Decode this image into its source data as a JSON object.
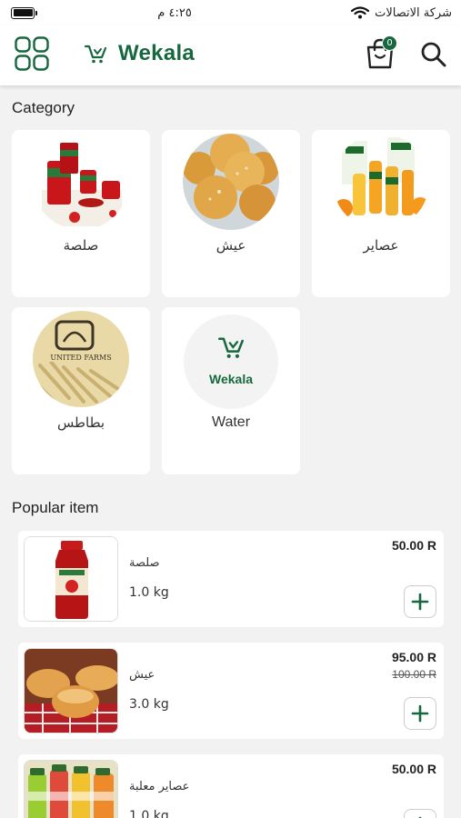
{
  "status_bar": {
    "time": "٤:٢٥ م",
    "carrier": "شركة الاتصالات"
  },
  "header": {
    "brand": "Wekala",
    "cart_count": "0"
  },
  "categories_section": {
    "title": "Category"
  },
  "categories": [
    {
      "label": "صلصة",
      "icon": "tomato-paste-image"
    },
    {
      "label": "عيش",
      "icon": "bread-rolls-image"
    },
    {
      "label": "عصاير",
      "icon": "juice-bottles-image"
    },
    {
      "label": "بطاطس",
      "icon": "fries-image"
    },
    {
      "label": "Water",
      "icon": "wekala-logo-placeholder",
      "placeholder_brand": "Wekala"
    }
  ],
  "popular_section": {
    "title": "Popular item"
  },
  "products": [
    {
      "name": "صلصة",
      "qty": "1.0 kg",
      "price": "50.00 R",
      "old_price": "",
      "icon": "tomato-sauce-jar-image"
    },
    {
      "name": "عيش",
      "qty": "3.0 kg",
      "price": "95.00 R",
      "old_price": "100.00 R",
      "icon": "buns-image"
    },
    {
      "name": "عصاير معلبة",
      "qty": "1.0 kg",
      "price": "50.00 R",
      "old_price": "",
      "icon": "bottled-juices-image"
    }
  ],
  "colors": {
    "brand_green": "#17683f",
    "background": "#f2f2f2",
    "card": "#ffffff"
  }
}
